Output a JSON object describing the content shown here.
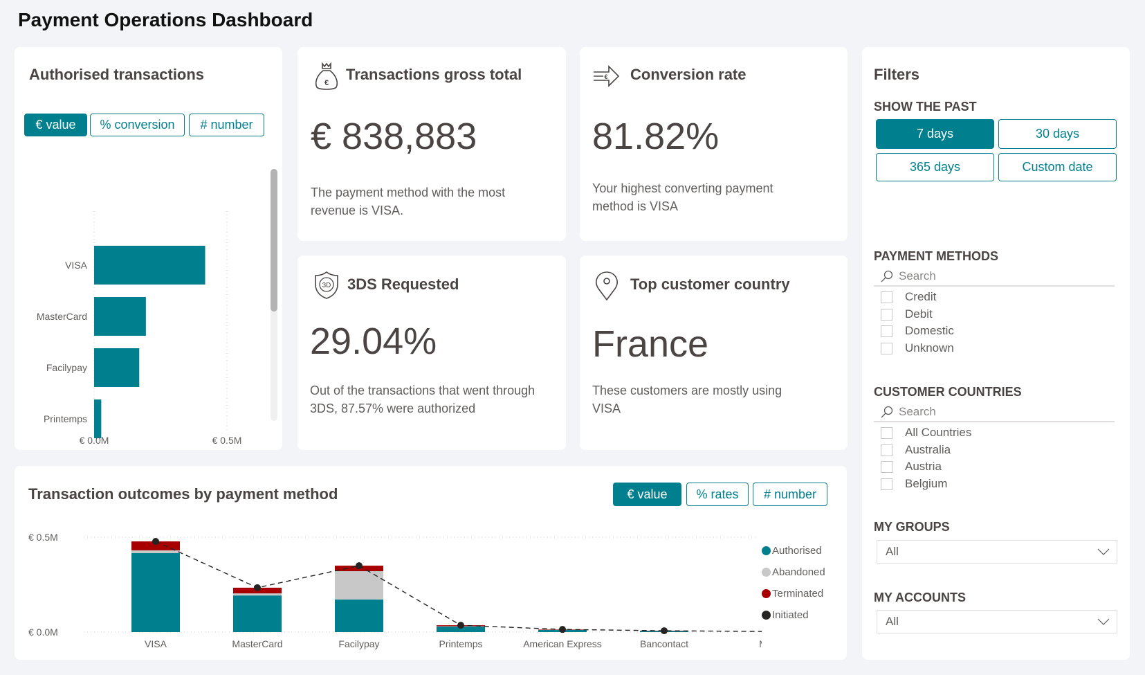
{
  "page": {
    "title": "Payment Operations Dashboard"
  },
  "colors": {
    "accent": "#00808f",
    "authorised": "#00808f",
    "abandoned": "#c8c8c8",
    "terminated": "#a80000",
    "initiated": "#252423",
    "text": "#4a4443"
  },
  "authorised_card": {
    "title": "Authorised transactions",
    "toggles": [
      {
        "label": "€ value",
        "active": true
      },
      {
        "label": "% conversion",
        "active": false
      },
      {
        "label": "# number",
        "active": false
      }
    ]
  },
  "gross_total_card": {
    "icon": "money-bag-euro-icon",
    "title": "Transactions gross total",
    "value": "€ 838,883",
    "description": "The payment method with the most revenue is VISA."
  },
  "conversion_card": {
    "icon": "euro-arrow-icon",
    "title": "Conversion rate",
    "value": "81.82%",
    "description": "Your highest converting payment method is VISA"
  },
  "threeds_card": {
    "icon": "shield-3d-icon",
    "title": "3DS Requested",
    "value": "29.04%",
    "description": "Out of the transactions that went through 3DS, 87.57% were authorized"
  },
  "country_card": {
    "icon": "location-pin-icon",
    "title": "Top customer country",
    "value": "France",
    "description": "These customers are mostly using VISA"
  },
  "outcomes_card": {
    "title": "Transaction outcomes by payment method",
    "toggles": [
      {
        "label": "€ value",
        "active": true
      },
      {
        "label": "% rates",
        "active": false
      },
      {
        "label": "# number",
        "active": false
      }
    ]
  },
  "filters": {
    "title": "Filters",
    "show_the_past": {
      "heading": "SHOW THE PAST",
      "options": [
        {
          "label": "7 days",
          "active": true
        },
        {
          "label": "30 days",
          "active": false
        },
        {
          "label": "365 days",
          "active": false
        },
        {
          "label": "Custom date",
          "active": false
        }
      ]
    },
    "payment_methods": {
      "heading": "PAYMENT METHODS",
      "search_placeholder": "Search",
      "items": [
        {
          "label": "Credit",
          "checked": false
        },
        {
          "label": "Debit",
          "checked": false
        },
        {
          "label": "Domestic",
          "checked": false
        },
        {
          "label": "Unknown",
          "checked": false
        }
      ]
    },
    "customer_countries": {
      "heading": "CUSTOMER COUNTRIES",
      "search_placeholder": "Search",
      "items": [
        {
          "label": "All Countries",
          "checked": false
        },
        {
          "label": "Australia",
          "checked": false
        },
        {
          "label": "Austria",
          "checked": false
        },
        {
          "label": "Belgium",
          "checked": false
        }
      ]
    },
    "my_groups": {
      "heading": "MY GROUPS",
      "value": "All"
    },
    "my_accounts": {
      "heading": "MY ACCOUNTS",
      "value": "All"
    }
  },
  "chart_data": [
    {
      "type": "bar",
      "orientation": "horizontal",
      "title": "Authorised transactions",
      "categories": [
        "VISA",
        "MasterCard",
        "Facilypay",
        "Printemps"
      ],
      "values": [
        0.418,
        0.195,
        0.17,
        0.027
      ],
      "unit": "€M",
      "xlim": [
        0,
        0.5
      ],
      "xticks": [
        "€ 0.0M",
        "€ 0.5M"
      ],
      "xlabel": "",
      "ylabel": "",
      "grid": true
    },
    {
      "type": "bar",
      "stacked": true,
      "title": "Transaction outcomes by payment method",
      "categories": [
        "VISA",
        "MasterCard",
        "Facilypay",
        "Printemps",
        "American Express",
        "Bancontact",
        "Ma"
      ],
      "series": [
        {
          "name": "Authorised",
          "values": [
            0.416,
            0.193,
            0.172,
            0.029,
            0.012,
            0.006,
            0.0
          ]
        },
        {
          "name": "Abandoned",
          "values": [
            0.015,
            0.011,
            0.149,
            0.002,
            0.001,
            0.0,
            0.0
          ]
        },
        {
          "name": "Terminated",
          "values": [
            0.047,
            0.03,
            0.029,
            0.005,
            0.001,
            0.001,
            0.0
          ]
        }
      ],
      "line_series": {
        "name": "Initiated",
        "values": [
          0.478,
          0.234,
          0.35,
          0.036,
          0.014,
          0.007,
          0.003
        ]
      },
      "unit": "€M",
      "ylim": [
        0,
        0.5
      ],
      "yticks": [
        "€ 0.0M",
        "€ 0.5M"
      ],
      "legend": "right",
      "grid": true
    }
  ]
}
